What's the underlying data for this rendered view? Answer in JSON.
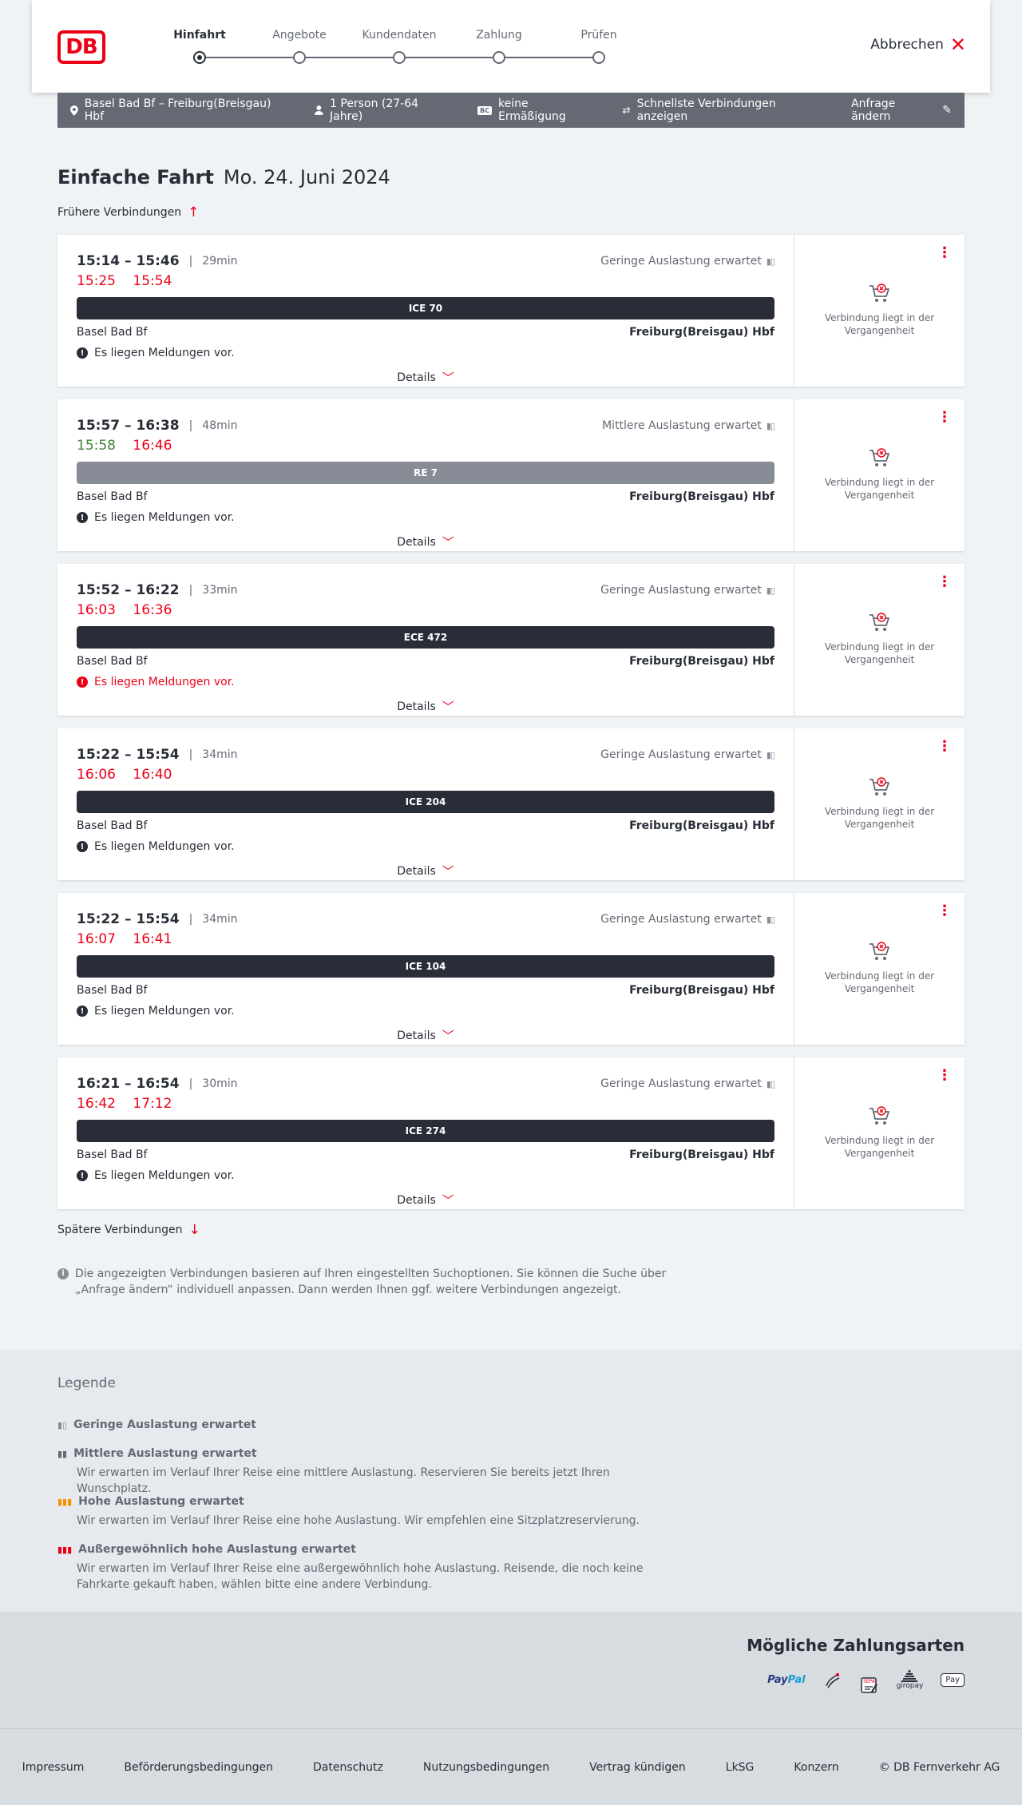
{
  "header": {
    "logo": "DB",
    "steps": [
      {
        "label": "Hinfahrt",
        "active": true
      },
      {
        "label": "Angebote",
        "active": false
      },
      {
        "label": "Kundendaten",
        "active": false
      },
      {
        "label": "Zahlung",
        "active": false
      },
      {
        "label": "Prüfen",
        "active": false
      }
    ],
    "cancel_label": "Abbrechen"
  },
  "query": {
    "route": "Basel Bad Bf – Freiburg(Breisgau) Hbf",
    "passengers": "1 Person (27-64 Jahre)",
    "discount_badge": "BC",
    "discount": "keine Ermäßigung",
    "fastest": "Schnellste Verbindungen anzeigen",
    "change": "Anfrage ändern"
  },
  "trip": {
    "type": "Einfache Fahrt",
    "date": "Mo. 24. Juni 2024",
    "earlier": "Frühere Verbindungen",
    "later": "Spätere Verbindungen"
  },
  "connections": [
    {
      "times": "15:14 – 15:46",
      "duration": "29min",
      "load": "Geringe Auslastung erwartet",
      "rt_dep": "15:25",
      "rt_arr": "15:54",
      "rt_dep_status": "late",
      "rt_arr_status": "late",
      "train": "ICE 70",
      "train_kind": "long",
      "from": "Basel Bad Bf",
      "to": "Freiburg(Breisgau) Hbf",
      "message": "Es liegen Meldungen vor.",
      "message_alert": false,
      "details": "Details",
      "past": "Verbindung liegt in der Vergangenheit"
    },
    {
      "times": "15:57 – 16:38",
      "duration": "48min",
      "load": "Mittlere Auslastung erwartet",
      "rt_dep": "15:58",
      "rt_arr": "16:46",
      "rt_dep_status": "ontime",
      "rt_arr_status": "late",
      "train": "RE 7",
      "train_kind": "regio",
      "from": "Basel Bad Bf",
      "to": "Freiburg(Breisgau) Hbf",
      "message": "Es liegen Meldungen vor.",
      "message_alert": false,
      "details": "Details",
      "past": "Verbindung liegt in der Vergangenheit"
    },
    {
      "times": "15:52 – 16:22",
      "duration": "33min",
      "load": "Geringe Auslastung erwartet",
      "rt_dep": "16:03",
      "rt_arr": "16:36",
      "rt_dep_status": "late",
      "rt_arr_status": "late",
      "train": "ECE 472",
      "train_kind": "long",
      "from": "Basel Bad Bf",
      "to": "Freiburg(Breisgau) Hbf",
      "message": "Es liegen Meldungen vor.",
      "message_alert": true,
      "details": "Details",
      "past": "Verbindung liegt in der Vergangenheit"
    },
    {
      "times": "15:22 – 15:54",
      "duration": "34min",
      "load": "Geringe Auslastung erwartet",
      "rt_dep": "16:06",
      "rt_arr": "16:40",
      "rt_dep_status": "late",
      "rt_arr_status": "late",
      "train": "ICE 204",
      "train_kind": "long",
      "from": "Basel Bad Bf",
      "to": "Freiburg(Breisgau) Hbf",
      "message": "Es liegen Meldungen vor.",
      "message_alert": false,
      "details": "Details",
      "past": "Verbindung liegt in der Vergangenheit"
    },
    {
      "times": "15:22 – 15:54",
      "duration": "34min",
      "load": "Geringe Auslastung erwartet",
      "rt_dep": "16:07",
      "rt_arr": "16:41",
      "rt_dep_status": "late",
      "rt_arr_status": "late",
      "train": "ICE 104",
      "train_kind": "long",
      "from": "Basel Bad Bf",
      "to": "Freiburg(Breisgau) Hbf",
      "message": "Es liegen Meldungen vor.",
      "message_alert": false,
      "details": "Details",
      "past": "Verbindung liegt in der Vergangenheit"
    },
    {
      "times": "16:21 – 16:54",
      "duration": "30min",
      "load": "Geringe Auslastung erwartet",
      "rt_dep": "16:42",
      "rt_arr": "17:12",
      "rt_dep_status": "late",
      "rt_arr_status": "late",
      "train": "ICE 274",
      "train_kind": "long",
      "from": "Basel Bad Bf",
      "to": "Freiburg(Breisgau) Hbf",
      "message": "Es liegen Meldungen vor.",
      "message_alert": false,
      "details": "Details",
      "past": "Verbindung liegt in der Vergangenheit"
    }
  ],
  "info_text": "Die angezeigten Verbindungen basieren auf Ihren eingestellten Suchoptionen. Sie können die Suche über „Anfrage ändern“ individuell anpassen. Dann werden Ihnen ggf. weitere Verbindungen angezeigt.",
  "legend": {
    "title": "Legende",
    "items": [
      {
        "title": "Geringe Auslastung erwartet",
        "desc": "",
        "color": "#878c96"
      },
      {
        "title": "Mittlere Auslastung erwartet",
        "desc": "Wir erwarten im Verlauf Ihrer Reise eine mittlere Auslastung. Reservieren Sie bereits jetzt Ihren Wunschplatz.",
        "color": "#646973"
      },
      {
        "title": "Hohe Auslastung erwartet",
        "desc": "Wir erwarten im Verlauf Ihrer Reise eine hohe Auslastung. Wir empfehlen eine Sitzplatzreservierung.",
        "color": "#f39200"
      },
      {
        "title": "Außergewöhnlich hohe Auslastung erwartet",
        "desc": "Wir erwarten im Verlauf Ihrer Reise eine außergewöhnlich hohe Auslastung. Reisende, die noch keine Fahrkarte gekauft haben, wählen bitte eine andere Verbindung.",
        "color": "#ec0016"
      }
    ]
  },
  "payments": {
    "title": "Mögliche Zahlungsarten",
    "paypal_a": "Pay",
    "paypal_b": "Pal",
    "sepa": "SEPA",
    "giropay": "giropay",
    "applepay": "Pay"
  },
  "footer": [
    "Impressum",
    "Beförderungsbedingungen",
    "Datenschutz",
    "Nutzungsbedingungen",
    "Vertrag kündigen",
    "LkSG",
    "Konzern",
    "© DB Fernverkehr AG"
  ],
  "colors": {
    "brand": "#ec0016",
    "ontime": "#408335",
    "dark": "#282d37",
    "muted": "#646973"
  }
}
